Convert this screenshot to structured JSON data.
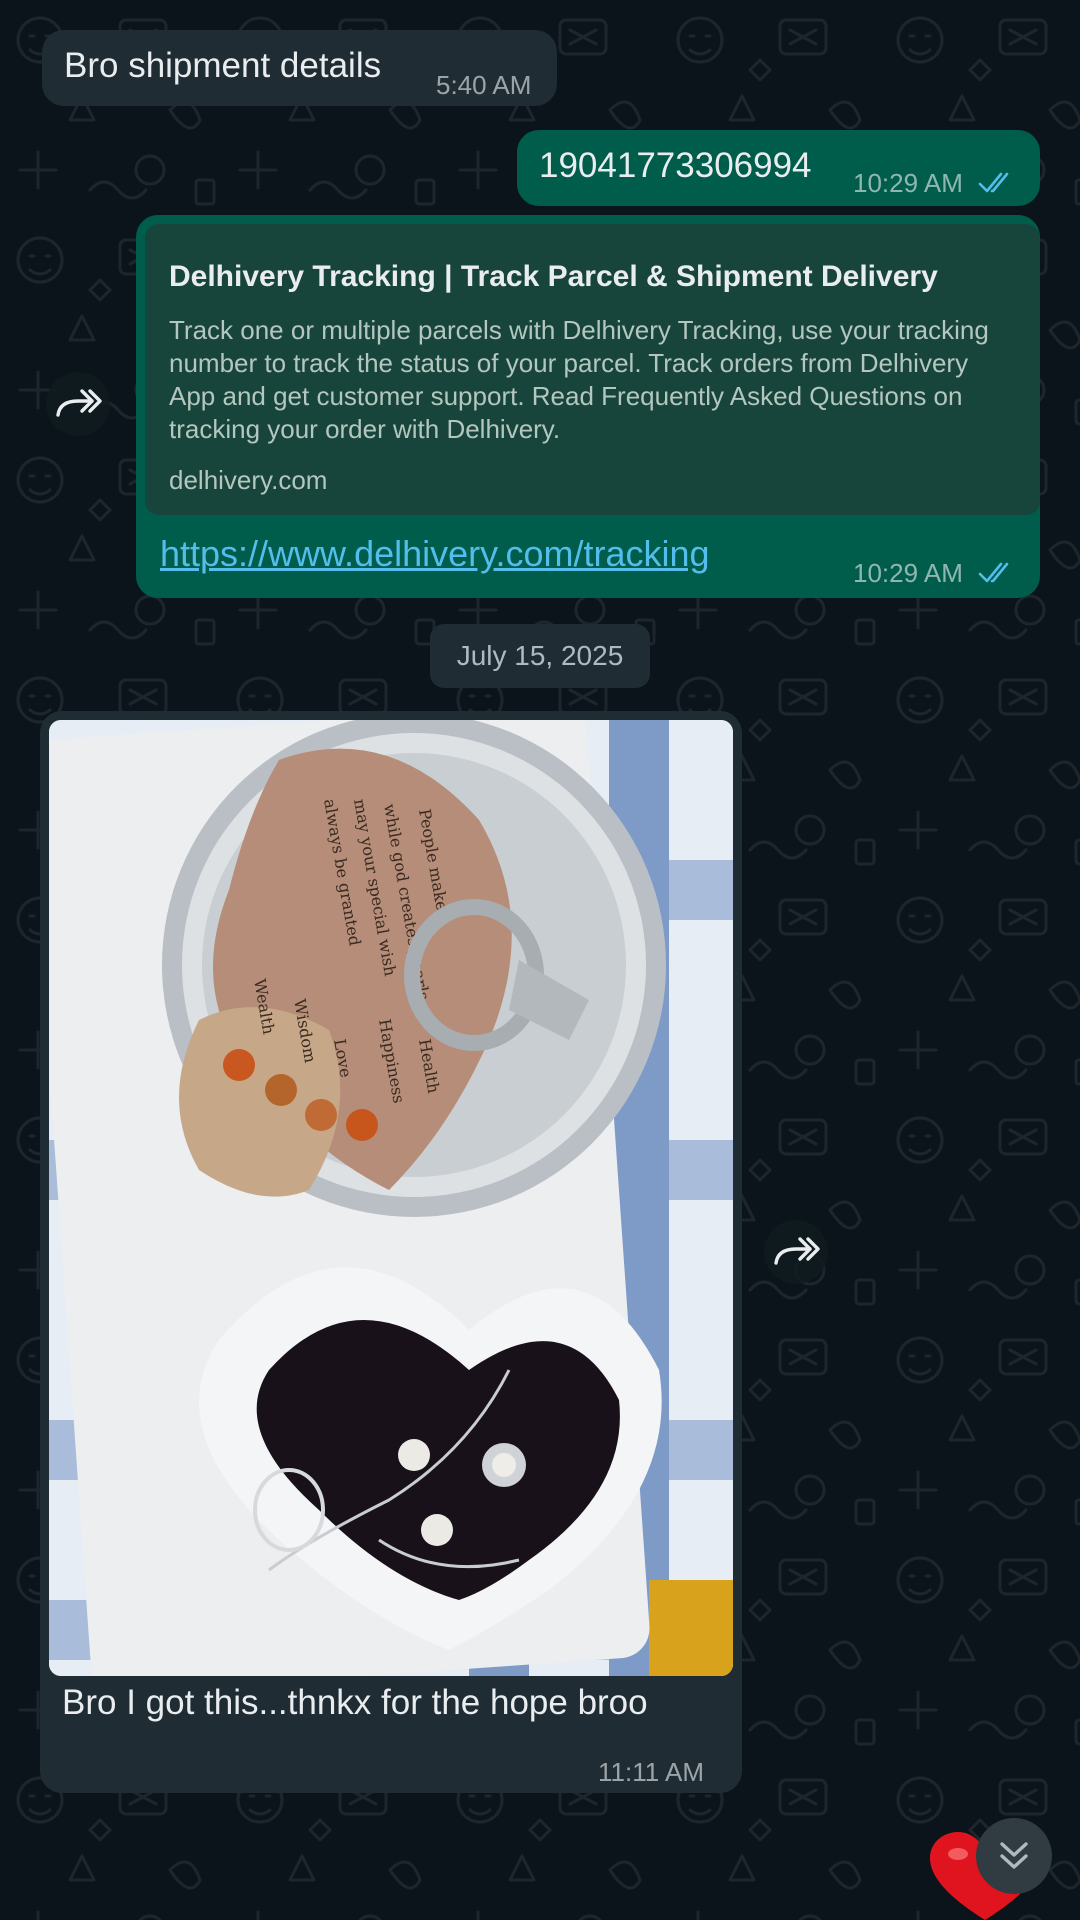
{
  "messages": {
    "shipment_request": {
      "text": "Bro shipment details",
      "time": "5:40 AM"
    },
    "tracking_number": {
      "text": "19041773306994",
      "time": "10:29 AM"
    },
    "link_preview": {
      "title": "Delhivery Tracking | Track Parcel & Shipment Delivery",
      "description": "Track one or multiple parcels with Delhivery Tracking, use your tracking number to track the status of your parcel. Track orders from Delhivery App and get customer support. Read Frequently Asked Questions on tracking your order with Delhivery.",
      "domain": "delhivery.com",
      "url": "https://www.delhivery.com/tracking",
      "time": "10:29 AM"
    },
    "photo_message": {
      "caption": "Bro I got this...thnkx for the hope broo",
      "time": "11:11 AM",
      "card_lines": [
        "People make",
        "while god creates pearls",
        "may your special wish",
        "always be granted",
        "Wealth",
        "Wisdom",
        "Love",
        "Happiness",
        "Health"
      ]
    }
  },
  "date_separator": "July 15, 2025",
  "icons": {
    "forward": "forward-icon",
    "read_receipt": "double-check-icon",
    "scroll_down": "double-chevron-down-icon",
    "reaction": "red-heart-icon"
  },
  "colors": {
    "background": "#0b141a",
    "incoming_bubble": "#202c33",
    "outgoing_bubble": "#005c4b",
    "link_preview": "#18453b",
    "link": "#53bdeb",
    "read_tick": "#53bdeb"
  }
}
